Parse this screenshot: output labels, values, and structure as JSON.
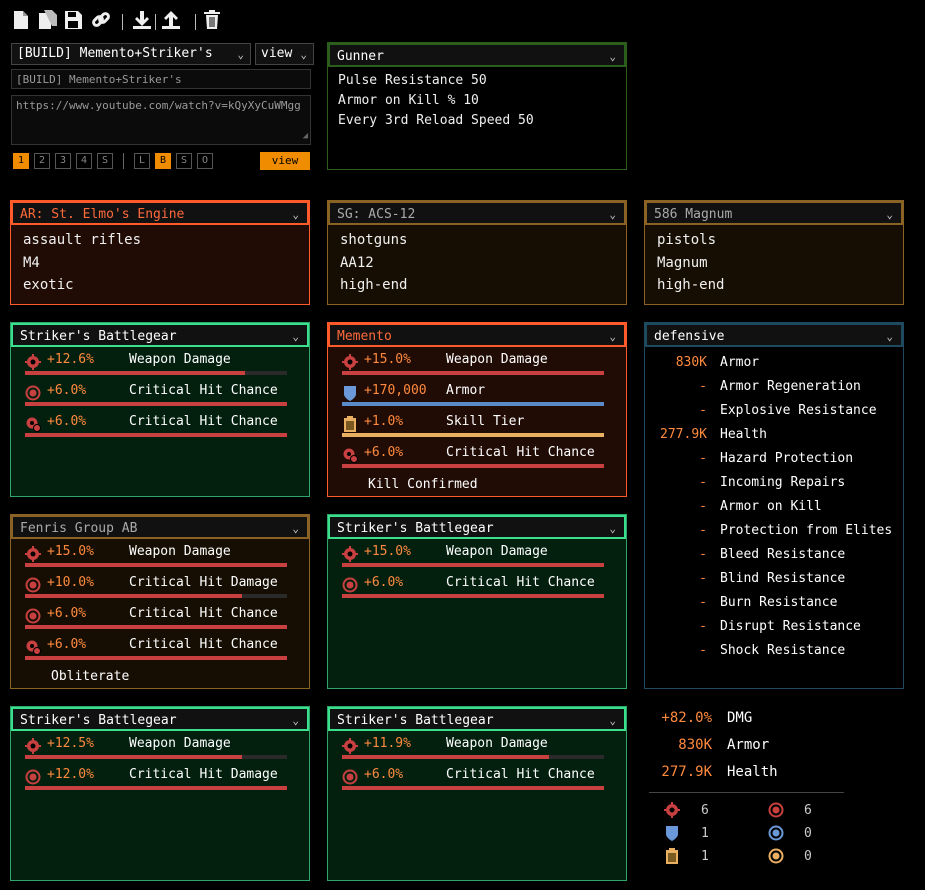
{
  "toolbar": {
    "icons": [
      "new-file-icon",
      "copy-file-icon",
      "save-icon",
      "link-icon",
      "import-icon",
      "export-icon",
      "trash-icon"
    ]
  },
  "build": {
    "selected": "[BUILD] Memento+Striker's",
    "mode": "view",
    "name_value": "[BUILD] Memento+Striker's",
    "url_value": "https://www.youtube.com/watch?v=kQyXyCuWMgg",
    "pages": [
      "1",
      "2",
      "3",
      "4",
      "S"
    ],
    "active_page": "1",
    "extras": [
      "L",
      "B",
      "S",
      "O"
    ],
    "active_extra": "B",
    "view_label": "view"
  },
  "specialization": {
    "name": "Gunner",
    "lines": [
      "Pulse Resistance 50",
      "Armor on Kill % 10",
      "Every 3rd Reload Speed 50"
    ]
  },
  "weapons": [
    {
      "title": "AR: St. Elmo's Engine",
      "lines": [
        "assault rifles",
        "M4",
        "exotic"
      ]
    },
    {
      "title": "SG: ACS-12",
      "lines": [
        "shotguns",
        "AA12",
        "high-end"
      ]
    },
    {
      "title": "586 Magnum",
      "lines": [
        "pistols",
        "Magnum",
        "high-end"
      ]
    }
  ],
  "gear": [
    {
      "title": "Striker's Battlegear",
      "attrs": [
        {
          "icon": "weapon-damage-icon",
          "value": "+12.6%",
          "name": "Weapon Damage",
          "fill": 0.84,
          "color": "#c84040"
        },
        {
          "icon": "critical-hit-icon",
          "value": "+6.0%",
          "name": "Critical Hit Chance",
          "fill": 1.0,
          "color": "#c84040"
        },
        {
          "icon": "critical-hit-gear-icon",
          "value": "+6.0%",
          "name": "Critical Hit Chance",
          "fill": 1.0,
          "color": "#c84040"
        }
      ],
      "talent": ""
    },
    {
      "title": "Memento",
      "attrs": [
        {
          "icon": "weapon-damage-icon",
          "value": "+15.0%",
          "name": "Weapon Damage",
          "fill": 1.0,
          "color": "#c84040"
        },
        {
          "icon": "armor-shield-icon",
          "value": "+170,000",
          "name": "Armor",
          "fill": 1.0,
          "color": "#5b8ac8"
        },
        {
          "icon": "skill-tier-battery-icon",
          "value": "+1.0%",
          "name": "Skill Tier",
          "fill": 1.0,
          "color": "#e8b060"
        },
        {
          "icon": "critical-hit-gear-icon",
          "value": "+6.0%",
          "name": "Critical Hit Chance",
          "fill": 1.0,
          "color": "#c84040"
        }
      ],
      "talent": "Kill Confirmed"
    },
    {
      "title": "Fenris Group AB",
      "attrs": [
        {
          "icon": "weapon-damage-icon",
          "value": "+15.0%",
          "name": "Weapon Damage",
          "fill": 1.0,
          "color": "#c84040"
        },
        {
          "icon": "critical-hit-icon",
          "value": "+10.0%",
          "name": "Critical Hit Damage",
          "fill": 0.83,
          "color": "#c84040"
        },
        {
          "icon": "critical-hit-icon",
          "value": "+6.0%",
          "name": "Critical Hit Chance",
          "fill": 1.0,
          "color": "#c84040"
        },
        {
          "icon": "critical-hit-gear-icon",
          "value": "+6.0%",
          "name": "Critical Hit Chance",
          "fill": 1.0,
          "color": "#c84040"
        }
      ],
      "talent": "Obliterate"
    },
    {
      "title": "Striker's Battlegear",
      "attrs": [
        {
          "icon": "weapon-damage-icon",
          "value": "+15.0%",
          "name": "Weapon Damage",
          "fill": 1.0,
          "color": "#c84040"
        },
        {
          "icon": "critical-hit-icon",
          "value": "+6.0%",
          "name": "Critical Hit Chance",
          "fill": 1.0,
          "color": "#c84040"
        }
      ],
      "talent": ""
    },
    {
      "title": "Striker's Battlegear",
      "attrs": [
        {
          "icon": "weapon-damage-icon",
          "value": "+12.5%",
          "name": "Weapon Damage",
          "fill": 0.83,
          "color": "#c84040"
        },
        {
          "icon": "critical-hit-icon",
          "value": "+12.0%",
          "name": "Critical Hit Damage",
          "fill": 1.0,
          "color": "#c84040"
        }
      ],
      "talent": ""
    },
    {
      "title": "Striker's Battlegear",
      "attrs": [
        {
          "icon": "weapon-damage-icon",
          "value": "+11.9%",
          "name": "Weapon Damage",
          "fill": 0.79,
          "color": "#c84040"
        },
        {
          "icon": "critical-hit-icon",
          "value": "+6.0%",
          "name": "Critical Hit Chance",
          "fill": 1.0,
          "color": "#c84040"
        }
      ],
      "talent": ""
    }
  ],
  "watch": {
    "category": "defensive",
    "rows": [
      {
        "value": "830K",
        "name": "Armor"
      },
      {
        "value": "-",
        "name": "Armor Regeneration"
      },
      {
        "value": "-",
        "name": "Explosive Resistance"
      },
      {
        "value": "277.9K",
        "name": "Health"
      },
      {
        "value": "-",
        "name": "Hazard Protection"
      },
      {
        "value": "-",
        "name": "Incoming Repairs"
      },
      {
        "value": "-",
        "name": "Armor on Kill"
      },
      {
        "value": "-",
        "name": "Protection from Elites"
      },
      {
        "value": "-",
        "name": "Bleed Resistance"
      },
      {
        "value": "-",
        "name": "Blind Resistance"
      },
      {
        "value": "-",
        "name": "Burn Resistance"
      },
      {
        "value": "-",
        "name": "Disrupt Resistance"
      },
      {
        "value": "-",
        "name": "Shock Resistance"
      }
    ]
  },
  "summary": {
    "stats": [
      {
        "value": "+82.0%",
        "name": "DMG"
      },
      {
        "value": "830K",
        "name": "Armor"
      },
      {
        "value": "277.9K",
        "name": "Health"
      }
    ],
    "core_counts": [
      {
        "icon": "weapon-damage-icon",
        "count": "6",
        "icon2": "critical-hit-icon",
        "count2": "6"
      },
      {
        "icon": "armor-shield-icon",
        "count": "1",
        "icon2": "armor-round-icon",
        "count2": "0"
      },
      {
        "icon": "skill-tier-battery-icon",
        "count": "1",
        "icon2": "skill-round-icon",
        "count2": "0"
      }
    ]
  },
  "colors": {
    "accent": "#f08c00",
    "value": "#ff8a3d",
    "gear_border": "#3be08c",
    "named_border": "#ff5a2a",
    "brand_border": "#8a6224"
  }
}
